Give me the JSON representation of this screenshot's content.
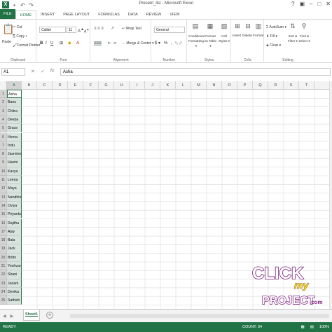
{
  "window": {
    "title": "Present_list - Microsoft Excel"
  },
  "qat": {
    "undo": "↶",
    "redo": "↷"
  },
  "wincontrols": {
    "help": "?",
    "restore": "▣",
    "minimize": "–",
    "maximize": "□",
    "close": "✕"
  },
  "tabs": [
    "FILE",
    "HOME",
    "INSERT",
    "PAGE LAYOUT",
    "FORMULAS",
    "DATA",
    "REVIEW",
    "VIEW"
  ],
  "ribbon": {
    "clipboard": {
      "paste": "Paste",
      "cut": "Cut",
      "copy": "Copy ▾",
      "format_painter": "Format Painter",
      "label": "Clipboard"
    },
    "font": {
      "name": "Calibri",
      "size": "11",
      "label": "Font"
    },
    "alignment": {
      "wrap": "Wrap Text",
      "merge": "Merge & Center ▾",
      "label": "Alignment"
    },
    "number": {
      "format": "General",
      "currency": "$ ▾",
      "percent": "%",
      "comma": ",",
      "label": "Number"
    },
    "styles": {
      "conditional": "Conditional Formatting ▾",
      "format_table": "Format as Table ▾",
      "cell_styles": "Cell Styles ▾",
      "label": "Styles"
    },
    "cells": {
      "insert": "Insert",
      "delete": "Delete",
      "format": "Format",
      "label": "Cells"
    },
    "editing": {
      "autosum": "AutoSum ▾",
      "fill": "Fill ▾",
      "clear": "Clear ▾",
      "sort": "Sort & Filter ▾",
      "find": "Find & Select ▾",
      "label": "Editing"
    }
  },
  "formula_bar": {
    "name_box": "A1",
    "cancel": "✕",
    "enter": "✓",
    "fx": "fx",
    "value": "Asha"
  },
  "columns": [
    "A",
    "B",
    "C",
    "D",
    "E",
    "F",
    "G",
    "H",
    "I",
    "J",
    "K",
    "L",
    "M",
    "N",
    "O",
    "P",
    "Q",
    "R",
    "S",
    "T"
  ],
  "rows": [
    "1",
    "2",
    "3",
    "4",
    "5",
    "6",
    "7",
    "8",
    "9",
    "10",
    "11",
    "12",
    "13",
    "14",
    "15",
    "16",
    "17",
    "18",
    "19",
    "20",
    "21",
    "22",
    "23",
    "24",
    "25"
  ],
  "names": [
    "Asha",
    "Banu",
    "Chitra",
    "Deepa",
    "Grace",
    "Hema",
    "Indu",
    "Jasmine",
    "Hasini",
    "Kavya",
    "Leena",
    "Maya",
    "Nandhini",
    "Oviya",
    "Priyanka",
    "Rajitha",
    "Ajay",
    "Bala",
    "Jack",
    "Britto",
    "Yeshvanth",
    "Shani",
    "Janani",
    "Devika",
    "Sathish"
  ],
  "sheet": {
    "name": "Sheet1",
    "add": "+"
  },
  "status": {
    "ready": "READY",
    "count": "COUNT: 34",
    "zoom": "100%"
  },
  "watermark": {
    "line1": "CLICK",
    "line2": "my",
    "line3": "PROJECT",
    "line4": ".com"
  },
  "colors": {
    "excel_green": "#217346",
    "selection_fill": "#d8e3de"
  }
}
